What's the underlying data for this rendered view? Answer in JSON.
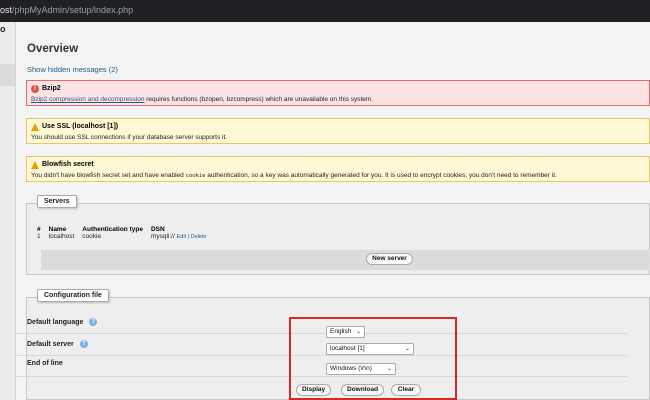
{
  "url": {
    "host": "ost",
    "path": "/phpMyAdmin/setup/index.php"
  },
  "side_title": "o",
  "page_title": "Overview",
  "hidden_messages_link": "Show hidden messages (2)",
  "notices": {
    "bzip": {
      "title": "Bzip2",
      "link_text": "Bzip2 compression and decompression",
      "body": " requires functions (bzopen, bzcompress) which are unavailable on this system."
    },
    "ssl": {
      "title": "Use SSL (localhost [1])",
      "body": "You should use SSL connections if your database server supports it."
    },
    "blowfish": {
      "title": "Blowfish secret",
      "body_before": "You didn't have blowfish secret set and have enabled ",
      "code": "cookie",
      "body_after": " authentication, so a key was automatically generated for you. It is used to encrypt cookies; you don't need to remember it."
    }
  },
  "servers": {
    "legend": "Servers",
    "columns": [
      "#",
      "Name",
      "Authentication type",
      "DSN"
    ],
    "rows": [
      {
        "num": "1",
        "name": "localhost",
        "auth": "cookie",
        "dsn": "mysqli://",
        "edit": "Edit",
        "sep": "|",
        "delete": "Delete"
      }
    ],
    "new_server_button": "New server"
  },
  "config": {
    "legend": "Configuration file",
    "default_language_label": "Default language",
    "default_language_value": "English",
    "default_server_label": "Default server",
    "default_server_value": "localhost [1]",
    "end_of_line_label": "End of line",
    "end_of_line_value": "Windows (\\r\\n)",
    "display_button": "Display",
    "download_button": "Download",
    "clear_button": "Clear"
  },
  "colors": {
    "annotation_box": "#d62828",
    "link": "#235a81"
  }
}
